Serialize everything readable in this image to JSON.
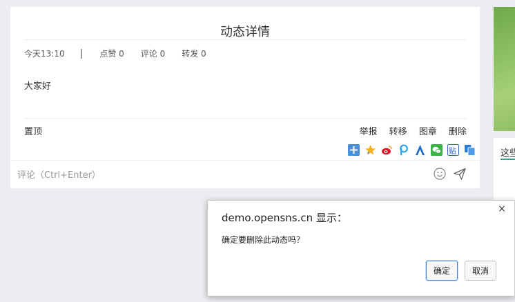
{
  "post": {
    "title": "动态详情",
    "time": "今天13:10",
    "separator": "|",
    "likes": "点赞 0",
    "comments": "评论 0",
    "reposts": "转发 0",
    "content": "大家好",
    "pin_label": "置顶",
    "actions": [
      "举报",
      "转移",
      "图章",
      "删除"
    ],
    "share_icons": [
      "qzone-share-icon",
      "qq-favorite-icon",
      "weibo-share-icon",
      "pengyou-share-icon",
      "renren-share-icon",
      "wechat-share-icon",
      "tieba-share-icon",
      "copy-share-icon"
    ],
    "comment_placeholder": "评论（Ctrl+Enter）"
  },
  "side": {
    "text": "这些"
  },
  "dialog": {
    "title": "demo.opensns.cn 显示：",
    "message": "确定要删除此动态吗？",
    "ok_label": "确定",
    "cancel_label": "取消",
    "close_glyph": "×"
  },
  "colors": {
    "background": "#ebedf0",
    "accent": "#2aa889",
    "focus": "#4a8ad6"
  }
}
